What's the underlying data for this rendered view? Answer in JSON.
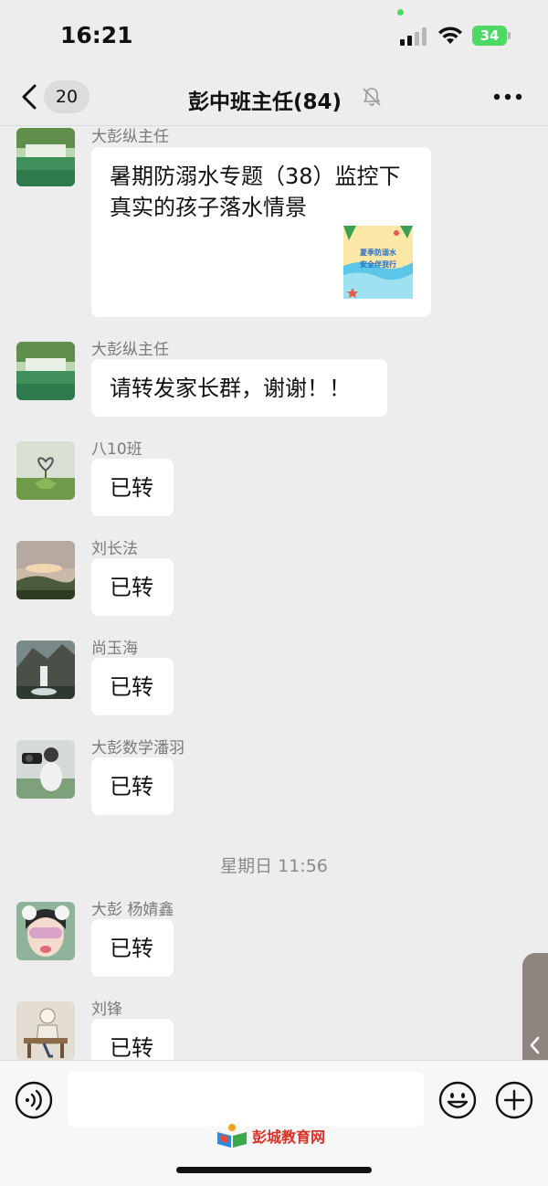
{
  "status_bar": {
    "time": "16:21",
    "battery": "34"
  },
  "nav": {
    "unread_count": "20",
    "title": "彭中班主任(84)"
  },
  "messages": [
    {
      "sender": "大彭纵主任",
      "text": "暑期防溺水专题（38）监控下真实的孩子落水情景",
      "thumb_line1": "夏季防溺水",
      "thumb_line2": "安全伴我行"
    },
    {
      "sender": "大彭纵主任",
      "text": "请转发家长群，谢谢！！"
    },
    {
      "sender": "八10班",
      "text": "已转"
    },
    {
      "sender": "刘长法",
      "text": "已转"
    },
    {
      "sender": "尚玉海",
      "text": "已转"
    },
    {
      "sender": "大彭数学潘羽",
      "text": "已转"
    },
    {
      "sender": "大彭 杨婧鑫",
      "text": "已转"
    },
    {
      "sender": "刘锋",
      "text": "已转"
    }
  ],
  "timestamp": "星期日 11:56",
  "watermark": "彭城教育网",
  "colors": {
    "background": "#ededed",
    "bubble": "#ffffff",
    "battery": "#4cd964",
    "watermark": "#d93025"
  },
  "icons": [
    "back-icon",
    "mute-icon",
    "more-icon",
    "voice-icon",
    "emoji-icon",
    "plus-icon",
    "chevron-left-icon"
  ]
}
